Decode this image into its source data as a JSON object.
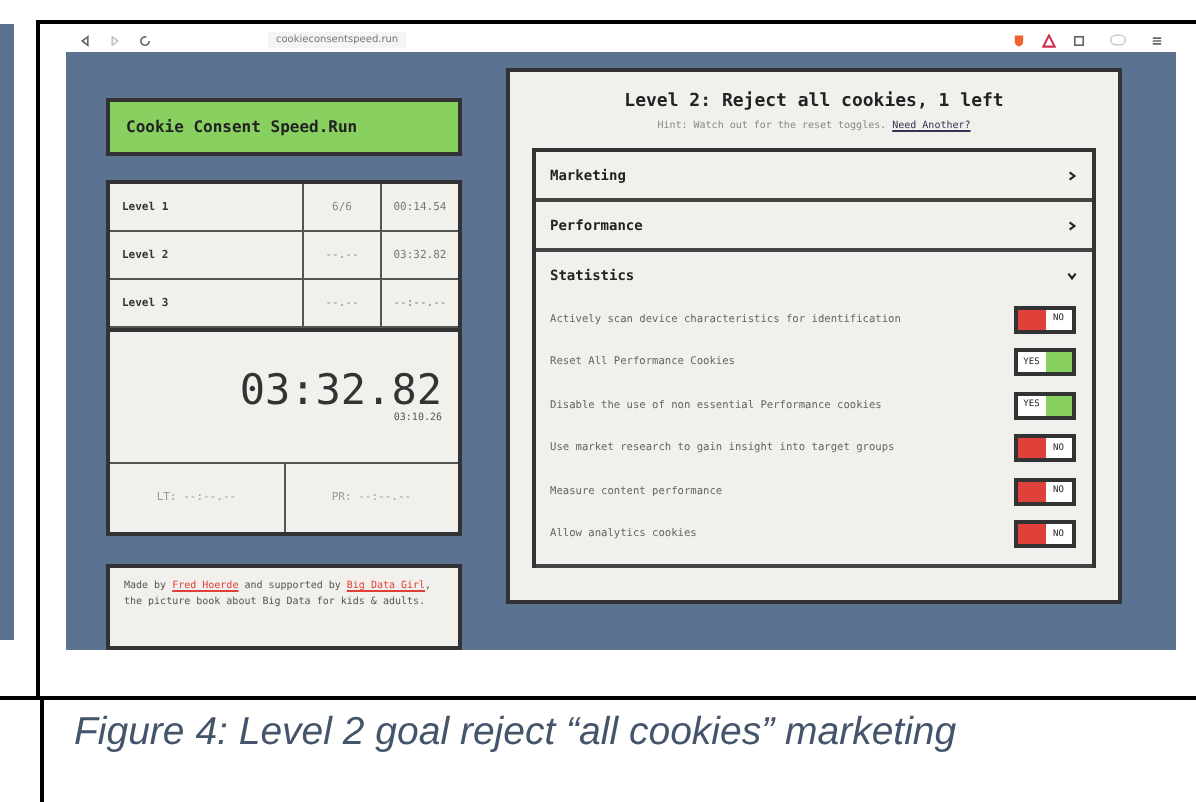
{
  "browser": {
    "url": "cookieconsentspeed.run"
  },
  "game": {
    "title": "Cookie Consent Speed.Run",
    "levels": [
      {
        "name": "Level 1",
        "count": "6/6",
        "time": "00:14.54"
      },
      {
        "name": "Level 2",
        "count": "--.--",
        "time": "03:32.82"
      },
      {
        "name": "Level 3",
        "count": "--.--",
        "time": "--:--.--"
      }
    ],
    "timer": "03:32.82",
    "subtimer": "03:10.26",
    "stats": [
      {
        "label": "LT:",
        "value": "--:--.--"
      },
      {
        "label": "PR:",
        "value": "--:--.--"
      }
    ],
    "footer": {
      "before": "Made by ",
      "link1": "Fred Hoerde",
      "middle": " and supported by ",
      "link2": "Big Data Girl",
      "after": ", the picture book about Big Data for kids & adults."
    }
  },
  "dialog": {
    "title": "Level 2: Reject all cookies, 1 left",
    "hint": "Hint: Watch out for the reset toggles.",
    "hint_link": "Need Another?",
    "sections": [
      {
        "title": "Marketing",
        "expanded": false
      },
      {
        "title": "Performance",
        "expanded": false
      },
      {
        "title": "Statistics",
        "expanded": true,
        "items": [
          {
            "label": "Actively scan device characteristics for identification",
            "on": false,
            "state": "NO"
          },
          {
            "label": "Reset All Performance Cookies",
            "on": true,
            "state": "YES"
          },
          {
            "label": "Disable the use of non essential Performance cookies",
            "on": true,
            "state": "YES"
          },
          {
            "label": "Use market research to gain insight into target groups",
            "on": false,
            "state": "NO"
          },
          {
            "label": "Measure content performance",
            "on": false,
            "state": "NO"
          },
          {
            "label": "Allow analytics cookies",
            "on": false,
            "state": "NO"
          }
        ]
      }
    ]
  },
  "caption": "Figure 4: Level 2 goal reject “all cookies” marketing"
}
